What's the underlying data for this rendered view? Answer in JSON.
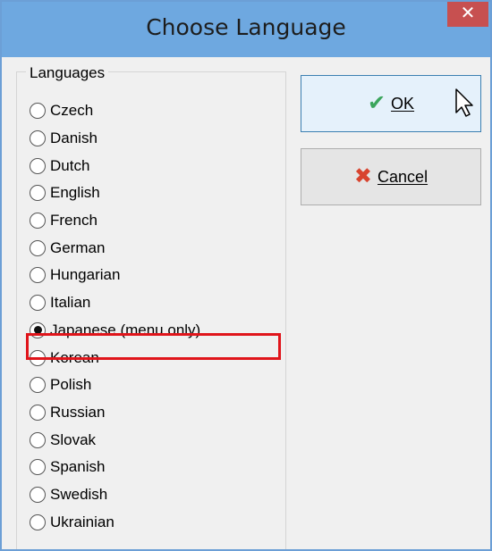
{
  "window": {
    "title": "Choose Language",
    "close_glyph": "✕"
  },
  "languages_group": {
    "legend": "Languages",
    "selected_index": 8,
    "items": [
      {
        "label": "Czech"
      },
      {
        "label": "Danish"
      },
      {
        "label": "Dutch"
      },
      {
        "label": "English"
      },
      {
        "label": "French"
      },
      {
        "label": "German"
      },
      {
        "label": "Hungarian"
      },
      {
        "label": "Italian"
      },
      {
        "label": "Japanese (menu only)"
      },
      {
        "label": "Korean"
      },
      {
        "label": "Polish"
      },
      {
        "label": "Russian"
      },
      {
        "label": "Slovak"
      },
      {
        "label": "Spanish"
      },
      {
        "label": "Swedish"
      },
      {
        "label": "Ukrainian"
      }
    ]
  },
  "buttons": {
    "ok_label": "OK",
    "ok_icon": "checkmark-icon",
    "cancel_label": "Cancel",
    "cancel_icon": "cross-icon"
  },
  "colors": {
    "titlebar": "#6ea8e0",
    "highlight": "#e0151b",
    "ok_icon": "#3ba55c",
    "cancel_icon": "#d8442f"
  }
}
